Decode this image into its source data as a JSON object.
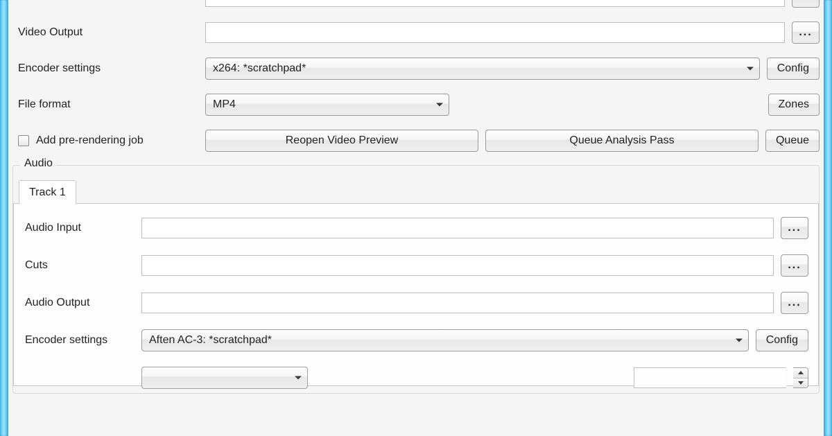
{
  "video": {
    "output_label": "Video Output",
    "output_value": "",
    "browse_ellipsis_output": "...",
    "encoder_label": "Encoder settings",
    "encoder_selected": "x264: *scratchpad*",
    "config_label": "Config",
    "format_label": "File format",
    "format_selected": "MP4",
    "zones_label": "Zones",
    "prerender_label": "Add pre-rendering job",
    "prerender_checked": false,
    "reopen_preview_label": "Reopen Video Preview",
    "queue_analysis_label": "Queue Analysis Pass",
    "queue_label": "Queue"
  },
  "audio": {
    "group_label": "Audio",
    "tabs": [
      {
        "label": "Track 1",
        "active": true
      }
    ],
    "input_label": "Audio Input",
    "input_value": "",
    "browse_input": "...",
    "cuts_label": "Cuts",
    "cuts_value": "",
    "browse_cuts": "...",
    "output_label": "Audio Output",
    "output_value": "",
    "browse_output": "...",
    "encoder_label": "Encoder settings",
    "encoder_selected": "Aften AC-3: *scratchpad*",
    "config_label": "Config"
  }
}
